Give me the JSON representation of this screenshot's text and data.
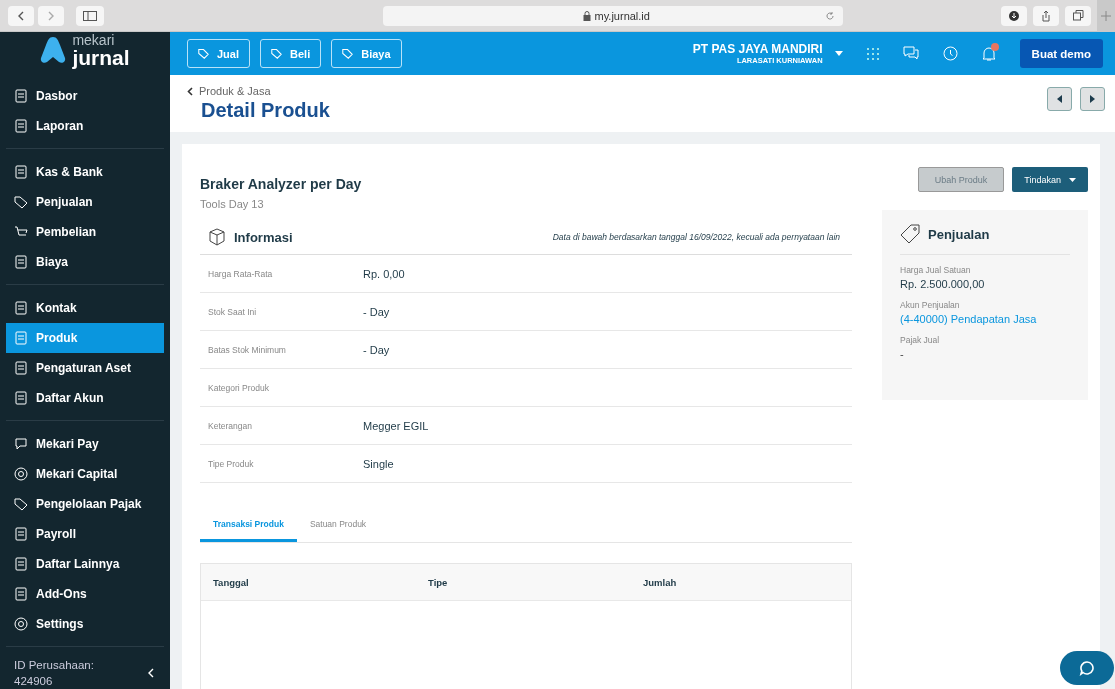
{
  "browser": {
    "url": "my.jurnal.id"
  },
  "sidebar": {
    "logo": {
      "top": "mekari",
      "bottom": "jurnal"
    },
    "groups": [
      [
        {
          "label": "Dasbor",
          "selected": false
        },
        {
          "label": "Laporan",
          "selected": false
        }
      ],
      [
        {
          "label": "Kas & Bank",
          "selected": false
        },
        {
          "label": "Penjualan",
          "selected": false
        },
        {
          "label": "Pembelian",
          "selected": false
        },
        {
          "label": "Biaya",
          "selected": false
        }
      ],
      [
        {
          "label": "Kontak",
          "selected": false
        },
        {
          "label": "Produk",
          "selected": true
        },
        {
          "label": "Pengaturan Aset",
          "selected": false
        },
        {
          "label": "Daftar Akun",
          "selected": false
        }
      ],
      [
        {
          "label": "Mekari Pay",
          "selected": false
        },
        {
          "label": "Mekari Capital",
          "selected": false
        },
        {
          "label": "Pengelolaan Pajak",
          "selected": false
        },
        {
          "label": "Payroll",
          "selected": false
        },
        {
          "label": "Daftar Lainnya",
          "selected": false
        },
        {
          "label": "Add-Ons",
          "selected": false
        },
        {
          "label": "Settings",
          "selected": false
        }
      ]
    ],
    "company_id_label": "ID Perusahaan:",
    "company_id": "424906"
  },
  "topbar": {
    "quick_buttons": [
      "Jual",
      "Beli",
      "Biaya"
    ],
    "company": "PT PAS JAYA MANDIRI",
    "user": "LARASATI KURNIAWAN",
    "has_notification": true,
    "demo_button": "Buat demo"
  },
  "page": {
    "breadcrumb": "Produk & Jasa",
    "title": "Detail Produk"
  },
  "product": {
    "name": "Braker Analyzer per Day",
    "code": "Tools Day 13",
    "edit_button": {
      "label": "Ubah Produk",
      "disabled": true
    },
    "actions_button": "Tindakan"
  },
  "info": {
    "title": "Informasi",
    "note": "Data di bawah berdasarkan tanggal 16/09/2022, kecuali ada pernyataan lain",
    "rows": [
      {
        "label": "Harga Rata-Rata",
        "value": "Rp. 0,00"
      },
      {
        "label": "Stok Saat Ini",
        "value": "- Day"
      },
      {
        "label": "Batas Stok Minimum",
        "value": "- Day"
      },
      {
        "label": "Kategori Produk"
      },
      {
        "label": "Keterangan",
        "value": "Megger EGIL"
      },
      {
        "label": "Tipe Produk",
        "value": "Single"
      }
    ]
  },
  "sales_panel": {
    "title": "Penjualan",
    "fields": [
      {
        "label": "Harga Jual Satuan",
        "value": "Rp. 2.500.000,00",
        "kind": "text"
      },
      {
        "label": "Akun Penjualan",
        "value": "(4-40000) Pendapatan Jasa",
        "kind": "link"
      },
      {
        "label": "Pajak Jual",
        "value": "-",
        "kind": "muted"
      }
    ]
  },
  "tabs": [
    {
      "label": "Transaksi Produk",
      "selected": true
    },
    {
      "label": "Satuan Produk",
      "selected": false
    }
  ],
  "table": {
    "columns": [
      "Tanggal",
      "Tipe",
      "Jumlah"
    ]
  }
}
